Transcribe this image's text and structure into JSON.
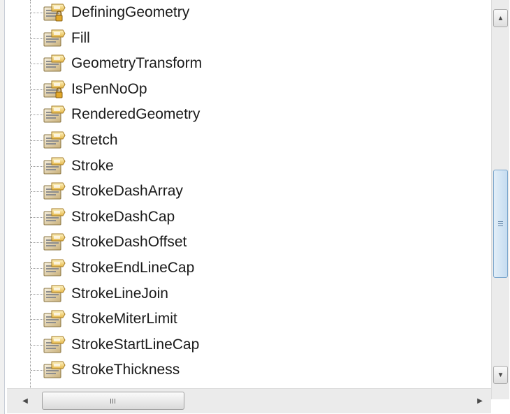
{
  "tree": {
    "items": [
      {
        "label": "DefiningGeometry",
        "icon": "property-icon",
        "locked": true
      },
      {
        "label": "Fill",
        "icon": "property-icon",
        "locked": false
      },
      {
        "label": "GeometryTransform",
        "icon": "property-icon",
        "locked": false
      },
      {
        "label": "IsPenNoOp",
        "icon": "property-icon",
        "locked": true
      },
      {
        "label": "RenderedGeometry",
        "icon": "property-icon",
        "locked": false
      },
      {
        "label": "Stretch",
        "icon": "property-icon",
        "locked": false
      },
      {
        "label": "Stroke",
        "icon": "property-icon",
        "locked": false
      },
      {
        "label": "StrokeDashArray",
        "icon": "property-icon",
        "locked": false
      },
      {
        "label": "StrokeDashCap",
        "icon": "property-icon",
        "locked": false
      },
      {
        "label": "StrokeDashOffset",
        "icon": "property-icon",
        "locked": false
      },
      {
        "label": "StrokeEndLineCap",
        "icon": "property-icon",
        "locked": false
      },
      {
        "label": "StrokeLineJoin",
        "icon": "property-icon",
        "locked": false
      },
      {
        "label": "StrokeMiterLimit",
        "icon": "property-icon",
        "locked": false
      },
      {
        "label": "StrokeStartLineCap",
        "icon": "property-icon",
        "locked": false
      },
      {
        "label": "StrokeThickness",
        "icon": "property-icon",
        "locked": false
      }
    ]
  },
  "scrollbars": {
    "vertical": {
      "up_glyph": "▲",
      "down_glyph": "▼",
      "position": 0.46
    },
    "horizontal": {
      "left_glyph": "◀",
      "right_glyph": "▶",
      "position": 0.0
    }
  },
  "colors": {
    "thumb_accent": "#c5dcf0",
    "icon_gold": "#e0b030"
  }
}
